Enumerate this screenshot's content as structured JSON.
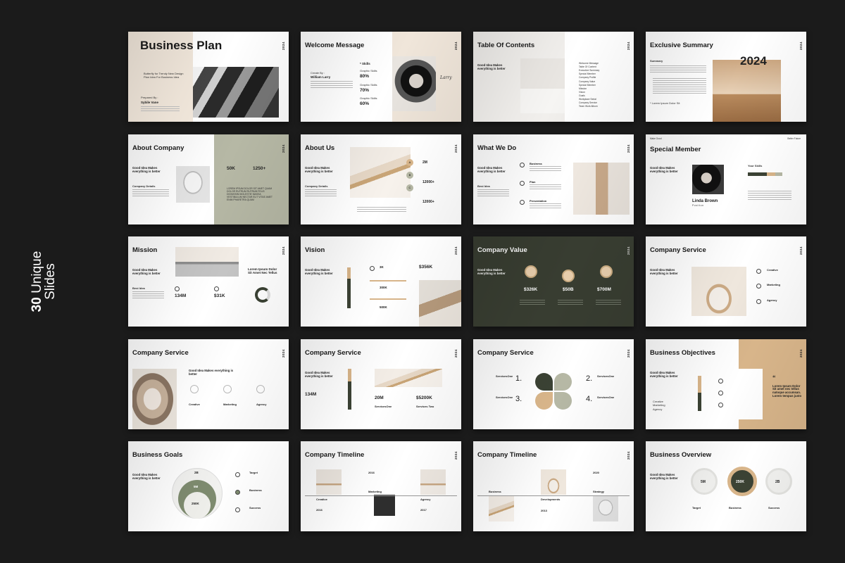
{
  "side_label": {
    "bold": "30",
    "line1_rest": " Unique",
    "line2": "Slides"
  },
  "colors": {
    "background": "#1b1b1b",
    "beige": "#f0e6da",
    "tan": "#d8b58a",
    "olive": "#b6b8a5",
    "dark_green": "#383d31",
    "text": "#1a1a1a"
  },
  "year": "2024",
  "slides": {
    "s1": {
      "title": "Business Plan",
      "blurb": "Butterfly for Trendy New Design Plan Idea For Business Idea",
      "prepared_label": "Prepared By :",
      "prepared_name": "Sybile Vane"
    },
    "s2": {
      "title": "Welcome Message",
      "created_label": "Create By :",
      "created_name": "William Larry",
      "skills": "* Skills",
      "stats": [
        "80%",
        "70%",
        "60%"
      ],
      "stat_label": "Graphic Skills",
      "signature": "Larry"
    },
    "s3": {
      "title": "Table Of Contents",
      "lead": "Good Idea Makes everything is better",
      "items": [
        "Welcome Message",
        "Table Of Content",
        "Executive Summary",
        "Special Member",
        "Company Profile",
        "Company Value",
        "Special Member",
        "Mission",
        "Vision",
        "Goals",
        "Workplace Serial",
        "Company Service",
        "Team Work Album"
      ]
    },
    "s4": {
      "title": "Exclusive Summary",
      "year_big": "2024",
      "summary_label": "Summary",
      "footnote": "* Lorem Ipsum Dolor Sit"
    },
    "s5": {
      "title": "About Company",
      "lead": "Good Idea Makes everything is better",
      "details_label": "Company Details",
      "stats": [
        "50K",
        "1250+"
      ],
      "caps": "LOREM IPSUM DOLOR SIT AMET QUAM DOLOR RUTRUM RUTRUM FELIS DIGNISSIM MOLESTIE MASSA VESTIBULUM NECTAR ELIT VITAE AMET ENIM PHARETRA QUAM"
    },
    "s6": {
      "title": "About Us",
      "lead": "Good Idea Makes everything is better",
      "details_label": "Company Details",
      "letters": [
        "A",
        "B",
        "C"
      ],
      "stats": [
        "2M",
        "12000+",
        "12000+"
      ]
    },
    "s7": {
      "title": "What We Do",
      "lead": "Good Idea Makes everything is better",
      "best_label": "Best Idea",
      "items": [
        "Business",
        "Plan",
        "Presentation"
      ]
    },
    "s8": {
      "title": "Special Member",
      "lead": "Good Idea Makes everything is better",
      "name": "Linda Brown",
      "role": "Position",
      "top_left": "Make Good",
      "top_right": "Better Future",
      "your_skills": "Your Skills"
    },
    "s9": {
      "title": "Mission",
      "lead": "Good Idea Makes everything is better",
      "best_label": "Best Idea",
      "quote": "Lorem Ipsum Dolor Sit Amet Nec Tellus",
      "stats": [
        "134M",
        "$31K"
      ]
    },
    "s10": {
      "title": "Vision",
      "lead": "Good Idea Makes everything is better",
      "stats": [
        "3K",
        "300K",
        "500K"
      ],
      "big": "$356K"
    },
    "s11": {
      "title": "Company Value",
      "lead": "Good Idea Makes everything is better",
      "stats": [
        "$326K",
        "$50B",
        "$700M"
      ]
    },
    "s12": {
      "title": "Company Service",
      "lead": "Good Idea Makes everything is better",
      "items": [
        "Creative",
        "Marketing",
        "Agency"
      ]
    },
    "s13": {
      "title": "Company Service",
      "lead": "Good Idea Makes everything is better",
      "items": [
        "Creative",
        "Marketing",
        "Agency"
      ]
    },
    "s14": {
      "title": "Company Service",
      "lead": "Good Idea Makes everything is better",
      "stats": [
        "134M",
        "20M",
        "$5200K"
      ],
      "labels": [
        "ServicesOne",
        "Services Two"
      ]
    },
    "s15": {
      "title": "Company Service",
      "numbers": [
        "1.",
        "2.",
        "3.",
        "4."
      ],
      "labels": [
        "ServicesOne",
        "ServicesOne",
        "ServicesOne",
        "ServicesOne"
      ]
    },
    "s16": {
      "title": "Business Objectives",
      "lead": "Good Idea Makes everything is better",
      "list": [
        "Creative",
        "Marketing",
        "Agency"
      ],
      "quote_mark": "“",
      "quote": "Lorem Ipsum Dolor Sit amet nec tellus natoque accumsan. Lorem tempus justo"
    },
    "s17": {
      "title": "Business Goals",
      "lead": "Good Idea Makes everything is better",
      "rings": [
        "2B",
        "5M",
        "250K"
      ],
      "items": [
        "Target",
        "Business",
        "Success"
      ]
    },
    "s18": {
      "title": "Company Timeline",
      "labels": [
        "Creative",
        "Marketing",
        "Agency"
      ],
      "years": [
        "2016",
        "2016",
        "2017"
      ]
    },
    "s19": {
      "title": "Company Timeline",
      "labels": [
        "Business",
        "Developments",
        "Strategy"
      ],
      "years": [
        "2020",
        "2013"
      ]
    },
    "s20": {
      "title": "Business Overview",
      "lead": "Good Idea Makes everything is better",
      "circles": [
        "5M",
        "250K",
        "2B"
      ],
      "labels": [
        "Target",
        "Business",
        "Success"
      ]
    }
  }
}
